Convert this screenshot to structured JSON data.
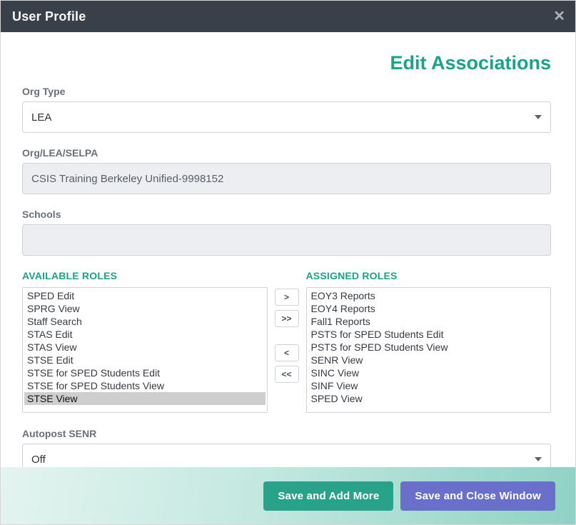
{
  "header": {
    "title": "User Profile"
  },
  "page": {
    "title": "Edit Associations"
  },
  "fields": {
    "org_type": {
      "label": "Org Type",
      "value": "LEA"
    },
    "org_lea": {
      "label": "Org/LEA/SELPA",
      "value": "CSIS Training Berkeley Unified-9998152"
    },
    "schools": {
      "label": "Schools",
      "value": ""
    },
    "autopost": {
      "label": "Autopost SENR",
      "value": "Off"
    }
  },
  "roles": {
    "available_label": "AVAILABLE ROLES",
    "assigned_label": "ASSIGNED ROLES",
    "available": [
      "SPED Edit",
      "SPRG View",
      "Staff Search",
      "STAS Edit",
      "STAS View",
      "STSE Edit",
      "STSE for SPED Students Edit",
      "STSE for SPED Students View",
      "STSE View"
    ],
    "available_selected": [
      "STSE View"
    ],
    "assigned": [
      "EOY3 Reports",
      "EOY4 Reports",
      "Fall1 Reports",
      "PSTS for SPED Students Edit",
      "PSTS for SPED Students View",
      "SENR View",
      "SINC View",
      "SINF View",
      "SPED View"
    ]
  },
  "move_buttons": {
    "add_one": ">",
    "add_all": ">>",
    "remove_one": "<",
    "remove_all": "<<"
  },
  "buttons": {
    "save_add_more": "Save and Add More",
    "save_close": "Save and Close Window"
  }
}
